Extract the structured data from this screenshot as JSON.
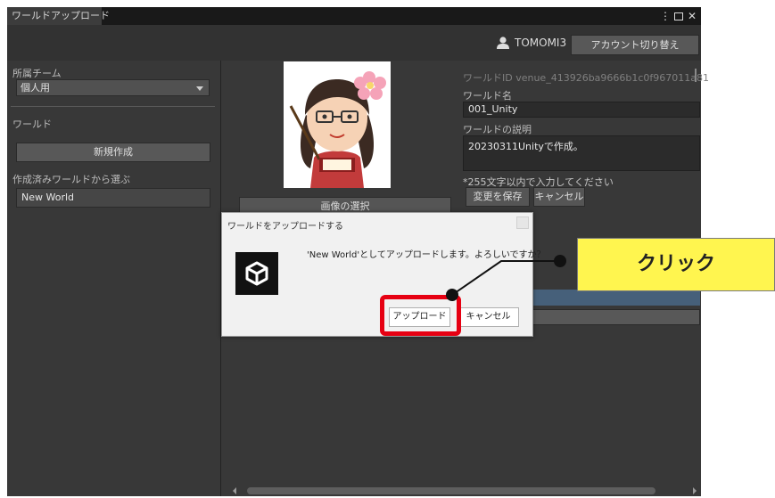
{
  "window": {
    "tab_title": "ワールドアップロード",
    "controls": [
      "⋮",
      "□",
      "✕"
    ]
  },
  "header": {
    "user_icon": "user-icon",
    "username": "TOMOMI3",
    "switch_account": "アカウント切り替え"
  },
  "sidebar": {
    "team_label": "所属チーム",
    "team_value": "個人用",
    "world_label": "ワールド",
    "new_button": "新規作成",
    "choose_label": "作成済みワールドから選ぶ",
    "world_item": "New World"
  },
  "main": {
    "select_image": "画像の選択",
    "world_id_label": "ワールドID venue_413926ba9666b1c0f967011a81",
    "world_name_label": "ワールド名",
    "world_name_value": "001_Unity",
    "desc_label": "ワールドの説明",
    "desc_value": "20230311Unityで作成。",
    "char_hint": "*255文字以内で入力してください",
    "save_button": "変更を保存",
    "cancel_button": "キャンセル"
  },
  "dialog": {
    "title": "ワールドをアップロードする",
    "message": "'New World'としてアップロードします。よろしいですか？",
    "upload_button": "アップロード",
    "cancel_button": "キャンセル",
    "logo_icon": "unity-logo-icon"
  },
  "annotation": {
    "callout": "クリック",
    "highlight_color": "#e60012",
    "callout_color": "#fff54f"
  }
}
